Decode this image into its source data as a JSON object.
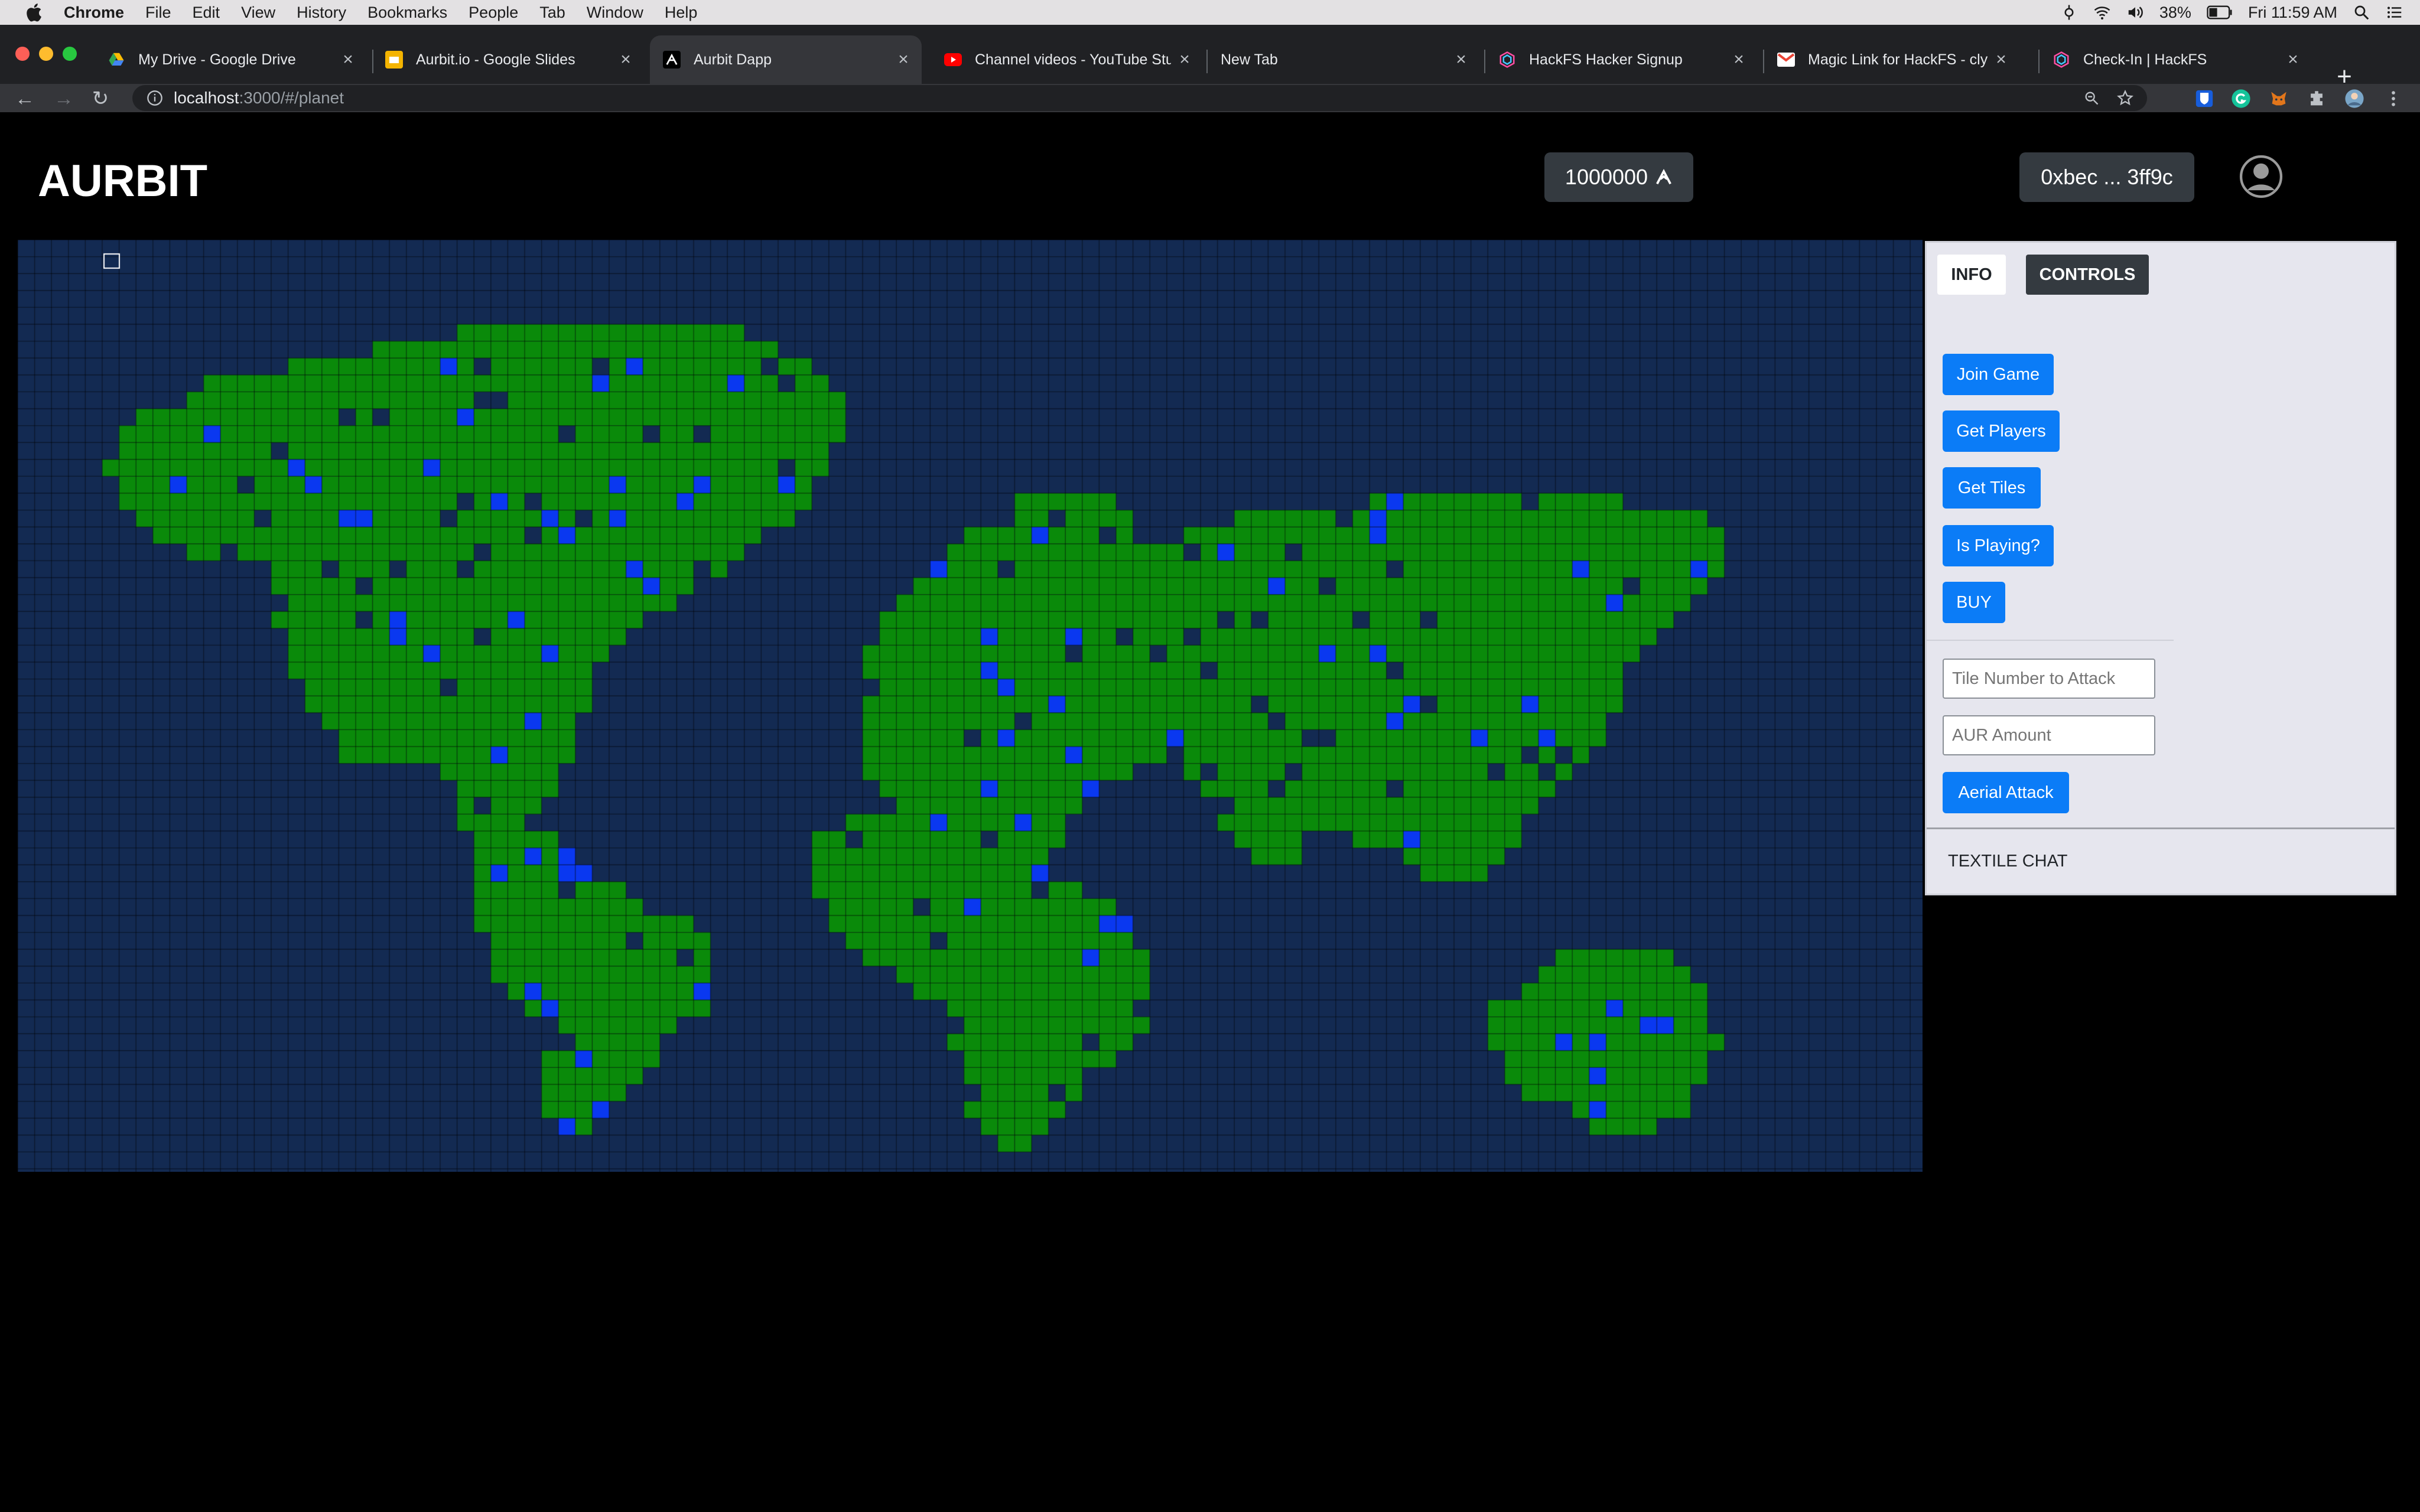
{
  "menubar": {
    "app_name": "Chrome",
    "items": [
      "File",
      "Edit",
      "View",
      "History",
      "Bookmarks",
      "People",
      "Tab",
      "Window",
      "Help"
    ],
    "battery": "38%",
    "clock": "Fri 11:59 AM"
  },
  "tabs": [
    {
      "title": "My Drive - Google Drive",
      "icon": "google-drive-icon"
    },
    {
      "title": "Aurbit.io - Google Slides",
      "icon": "google-slides-icon"
    },
    {
      "title": "Aurbit Dapp",
      "icon": "aurbit-icon",
      "active": true
    },
    {
      "title": "Channel videos - YouTube Stu",
      "icon": "youtube-icon"
    },
    {
      "title": "New Tab",
      "icon": ""
    },
    {
      "title": "HackFS Hacker Signup",
      "icon": "hackfs-icon"
    },
    {
      "title": "Magic Link for HackFS - clync",
      "icon": "gmail-icon"
    },
    {
      "title": "Check-In | HackFS",
      "icon": "hackfs-icon"
    }
  ],
  "address_bar": {
    "host": "localhost",
    "path": ":3000/#/planet"
  },
  "app": {
    "logo_text": "AURBIT",
    "balance": "1000000",
    "wallet": "0xbec ... 3ff9c"
  },
  "panel": {
    "tab_info": "INFO",
    "tab_controls": "CONTROLS",
    "buttons": {
      "join": "Join Game",
      "players": "Get Players",
      "tiles": "Get Tiles",
      "playing": "Is Playing?",
      "buy": "BUY",
      "attack": "Aerial Attack"
    },
    "tile_placeholder": "Tile Number to Attack",
    "amount_placeholder": "AUR Amount",
    "chat_label": "TEXTILE CHAT"
  },
  "map": {
    "ocean_color": "#132a52",
    "land_color": "#0a8a0a",
    "owned_color": "#0a38f0"
  }
}
